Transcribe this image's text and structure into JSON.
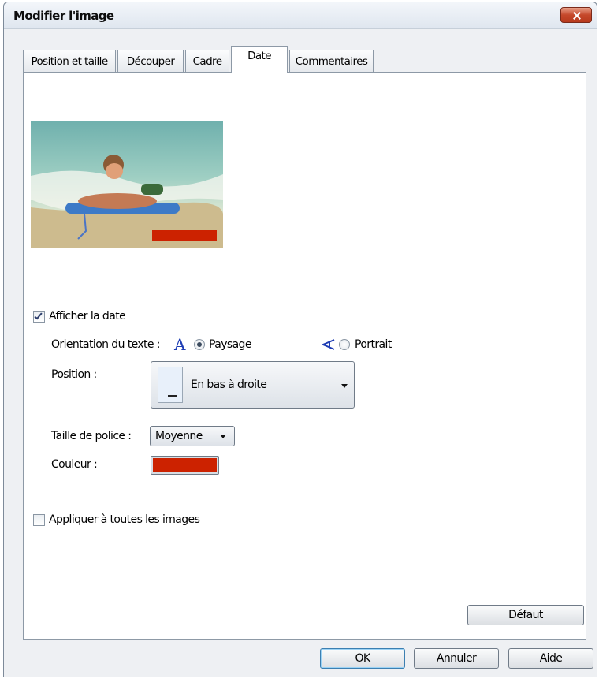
{
  "window": {
    "title": "Modifier l'image"
  },
  "tabs": [
    "Position et taille",
    "Découper",
    "Cadre",
    "Date",
    "Commentaires"
  ],
  "active_tab": "Date",
  "date": {
    "show_date_label": "Afficher la date",
    "show_date_checked": true,
    "orientation_label": "Orientation du texte :",
    "landscape_label": "Paysage",
    "portrait_label": "Portrait",
    "orientation_selected": "Paysage",
    "position_label": "Position :",
    "position_value": "En bas à droite",
    "font_size_label": "Taille de police :",
    "font_size_value": "Moyenne",
    "color_label": "Couleur :",
    "color_value": "#cc2200"
  },
  "apply_all": {
    "label": "Appliquer à toutes les images",
    "checked": false
  },
  "buttons": {
    "default": "Défaut",
    "ok": "OK",
    "cancel": "Annuler",
    "help": "Aide"
  },
  "icons": {
    "close": "close-icon",
    "landscape": "text-a-icon",
    "portrait": "rotated-text-icon",
    "position": "bottom-right-position-icon"
  },
  "colors": {
    "date_stamp": "#cc2200",
    "accent": "#1e3db4"
  }
}
